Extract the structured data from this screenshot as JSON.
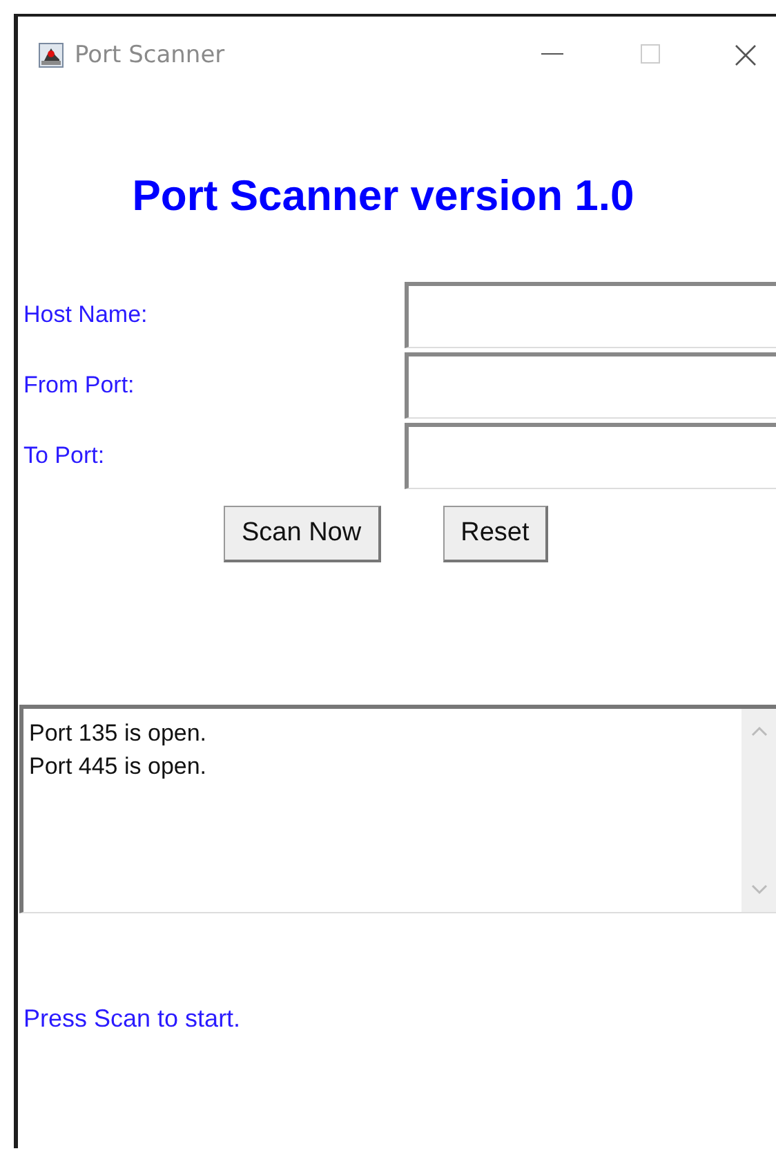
{
  "window": {
    "title": "Port Scanner"
  },
  "heading": "Port Scanner version 1.0",
  "fields": [
    {
      "label": "Host Name:"
    },
    {
      "label": "From Port:"
    },
    {
      "label": "To Port:"
    }
  ],
  "buttons": [
    "Scan Now",
    "Reset"
  ],
  "output": [
    "Port 135 is open.",
    "Port 445 is open."
  ],
  "status": "Press Scan to start."
}
